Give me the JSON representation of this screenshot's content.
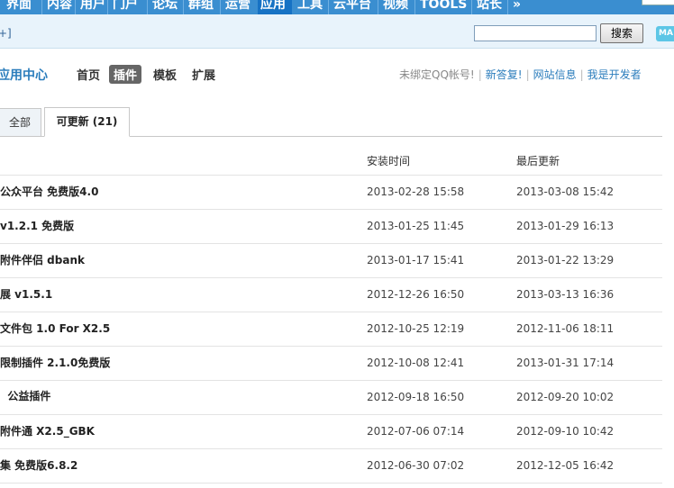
{
  "topnav": {
    "items": [
      "界面",
      "内容",
      "用户",
      "门户",
      "论坛",
      "群组",
      "运营",
      "应用",
      "工具",
      "云平台",
      "视频",
      "TOOLS",
      "站长",
      "»"
    ],
    "active_index": 7
  },
  "searchbar": {
    "plus": "+]",
    "search_value": "",
    "search_button": "搜索",
    "badge": "MA"
  },
  "app_header": {
    "title": "应用中心",
    "nav": [
      "首页",
      "插件",
      "模板",
      "扩展"
    ],
    "active_nav": "插件",
    "notice": "未绑定QQ帐号!",
    "links": [
      "新答复!",
      "网站信息",
      "我是开发者"
    ]
  },
  "tabs": {
    "all": "全部",
    "updatable": "可更新 (21)"
  },
  "table": {
    "headers": {
      "install_time": "安装时间",
      "last_update": "最后更新"
    },
    "rows": [
      {
        "name": "公众平台  免费版4.0",
        "install": "2013-02-28 15:58",
        "update": "2013-03-08 15:42"
      },
      {
        "name": "v1.2.1 免费版",
        "install": "2013-01-25 11:45",
        "update": "2013-01-29 16:13"
      },
      {
        "name": "附件伴侣  dbank",
        "install": "2013-01-17 15:41",
        "update": "2013-01-22 13:29"
      },
      {
        "name": "展  v1.5.1",
        "install": "2012-12-26 16:50",
        "update": "2013-03-13 16:36"
      },
      {
        "name": "文件包  1.0 For X2.5",
        "install": "2012-10-25 12:19",
        "update": "2012-11-06 18:11"
      },
      {
        "name": "限制插件  2.1.0免费版",
        "install": "2012-10-08 12:41",
        "update": "2013-01-31 17:14"
      },
      {
        "name": "  公益插件",
        "install": "2012-09-18 16:50",
        "update": "2012-09-20 10:02"
      },
      {
        "name": "附件通  X2.5_GBK",
        "install": "2012-07-06 07:14",
        "update": "2012-09-10 10:42"
      },
      {
        "name": "集  免费版6.8.2",
        "install": "2012-06-30 07:02",
        "update": "2012-12-05 16:42"
      }
    ]
  }
}
